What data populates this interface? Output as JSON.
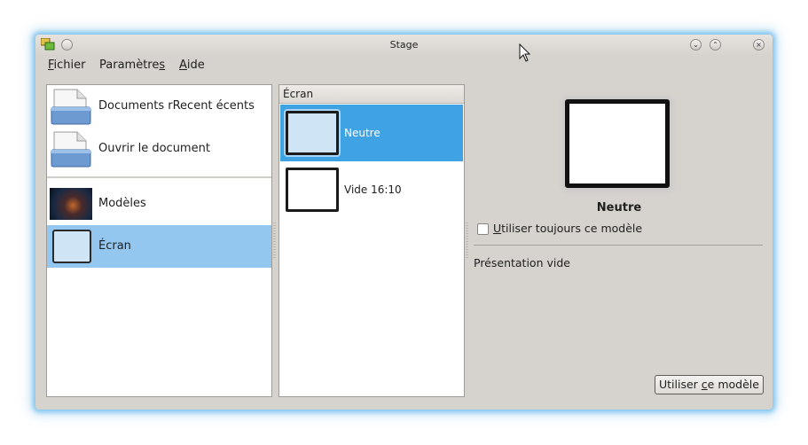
{
  "window": {
    "title": "Stage",
    "accent": "#3fa2e3"
  },
  "menu": {
    "fichier_first": "F",
    "fichier_rest": "ichier",
    "param_main": "Paramètre",
    "param_ul": "s",
    "aide_first": "A",
    "aide_rest": "ide"
  },
  "left_panel": {
    "items": [
      {
        "label": "Documents rRecent écents",
        "icon": "recent-documents-icon"
      },
      {
        "label": "Ouvrir le document",
        "icon": "open-document-icon"
      },
      {
        "label": "Modèles",
        "icon": "templates-thumbnail"
      },
      {
        "label": "Écran",
        "icon": "screen-icon",
        "selected": true
      }
    ]
  },
  "middle_panel": {
    "header": "Écran",
    "templates": [
      {
        "label": "Neutre",
        "selected": true
      },
      {
        "label": "Vide 16:10",
        "selected": false
      }
    ]
  },
  "details": {
    "name": "Neutre",
    "always_use_ul": "U",
    "always_use_rest": "tiliser toujours ce modèle",
    "always_use_checked": false,
    "description": "Présentation vide",
    "use_btn_pre": "Utiliser ",
    "use_btn_ul": "c",
    "use_btn_post": "e modèle"
  }
}
